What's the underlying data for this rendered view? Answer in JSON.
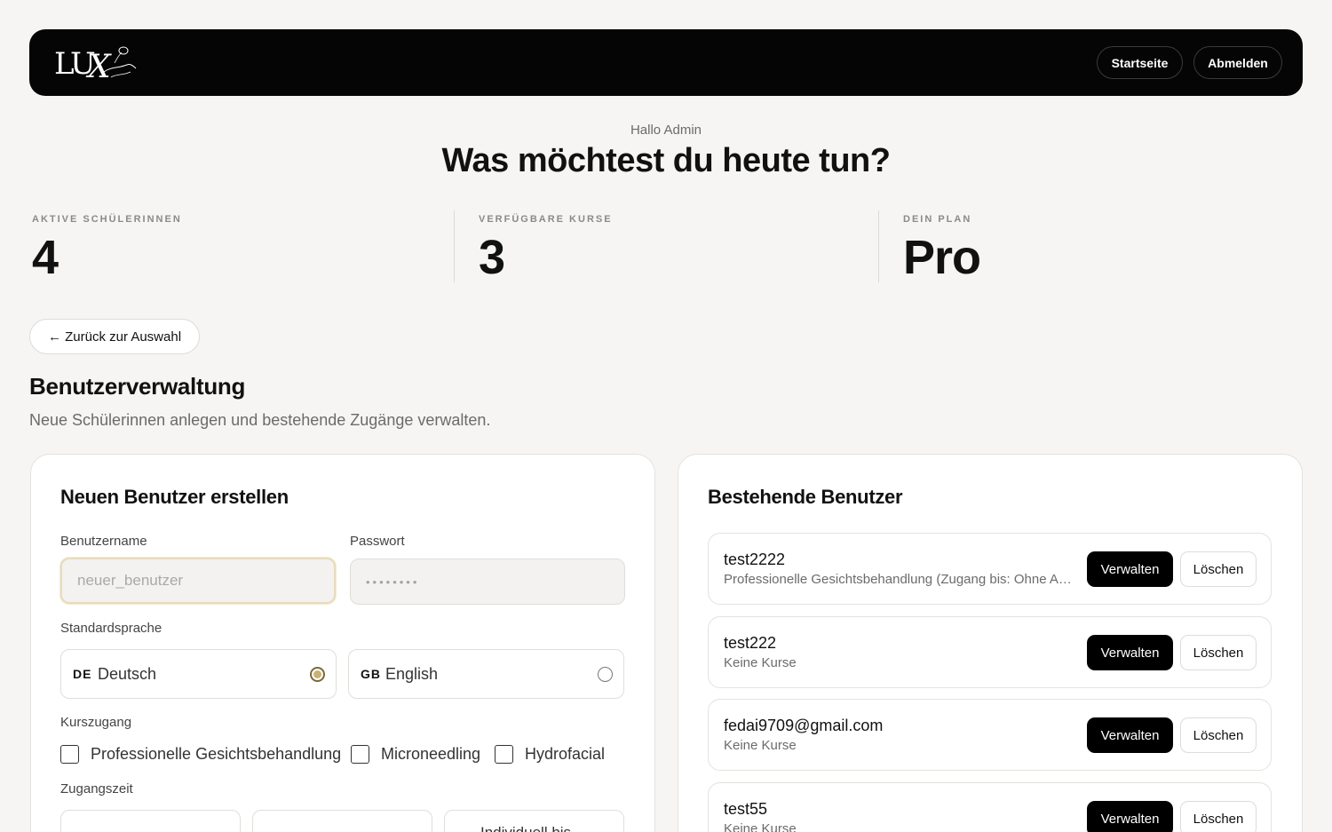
{
  "header": {
    "logo_alt": "LUX Beauty",
    "nav": {
      "home": "Startseite",
      "logout": "Abmelden"
    }
  },
  "hero": {
    "greeting": "Hallo Admin",
    "headline": "Was möchtest du heute tun?"
  },
  "stats": [
    {
      "label": "AKTIVE SCHÜLERINNEN",
      "value": "4"
    },
    {
      "label": "VERFÜGBARE KURSE",
      "value": "3"
    },
    {
      "label": "DEIN PLAN",
      "value": "Pro"
    }
  ],
  "back_button": "← Zurück zur Auswahl",
  "section": {
    "title": "Benutzerverwaltung",
    "subtitle": "Neue Schülerinnen anlegen und bestehende Zugänge verwalten."
  },
  "create_form": {
    "title": "Neuen Benutzer erstellen",
    "username": {
      "label": "Benutzername",
      "placeholder": "neuer_benutzer"
    },
    "password": {
      "label": "Passwort",
      "placeholder": "••••••••"
    },
    "language": {
      "label": "Standardsprache",
      "options": [
        {
          "code": "DE",
          "label": "Deutsch",
          "selected": true
        },
        {
          "code": "GB",
          "label": "English",
          "selected": false
        }
      ]
    },
    "courses": {
      "label": "Kurszugang",
      "options": [
        "Professionelle Gesichtsbehandlung",
        "Microneedling",
        "Hydrofacial"
      ]
    },
    "access_time": {
      "label": "Zugangszeit",
      "options": [
        "",
        "",
        "Individuell bis"
      ]
    }
  },
  "users_panel": {
    "title": "Bestehende Benutzer",
    "manage_label": "Verwalten",
    "delete_label": "Löschen",
    "users": [
      {
        "name": "test2222",
        "courses": "Professionelle Gesichtsbehandlung (Zugang bis: Ohne Ablaufdatum)"
      },
      {
        "name": "test222",
        "courses": "Keine Kurse"
      },
      {
        "name": "fedai9709@gmail.com",
        "courses": "Keine Kurse"
      },
      {
        "name": "test55",
        "courses": "Keine Kurse"
      }
    ]
  },
  "colors": {
    "accent_gold": "#c9b074",
    "header_bg": "#050505",
    "page_bg": "#f6f5f3"
  }
}
